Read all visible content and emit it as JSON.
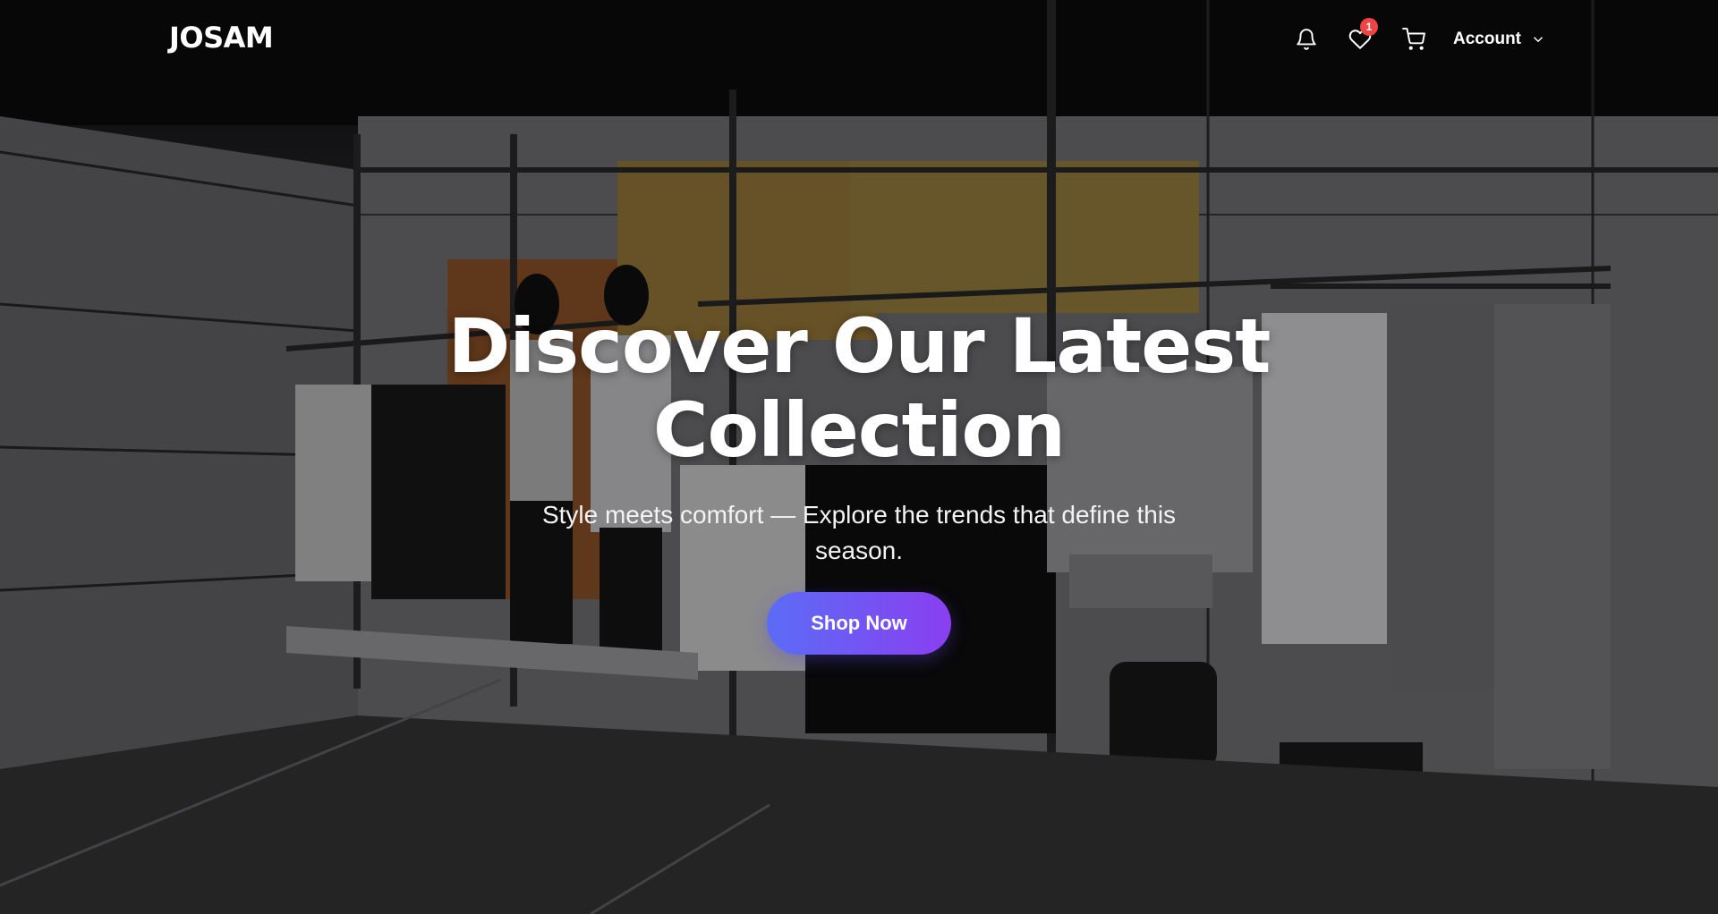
{
  "brand": {
    "logo_text": "JOSAM"
  },
  "header": {
    "notifications_icon": "bell-icon",
    "wishlist_icon": "heart-icon",
    "wishlist_count": "1",
    "cart_icon": "cart-icon",
    "account_label": "Account",
    "account_chevron_icon": "chevron-down-icon"
  },
  "hero": {
    "title": "Discover Our Latest Collection",
    "subtitle": "Style meets comfort — Explore the trends that define this season.",
    "cta_label": "Shop Now",
    "background_description_icon": "store-interior-image"
  },
  "colors": {
    "cta_gradient_start": "#5b6cf6",
    "cta_gradient_end": "#8a3ff0",
    "badge": "#ef4444",
    "text": "#ffffff"
  }
}
